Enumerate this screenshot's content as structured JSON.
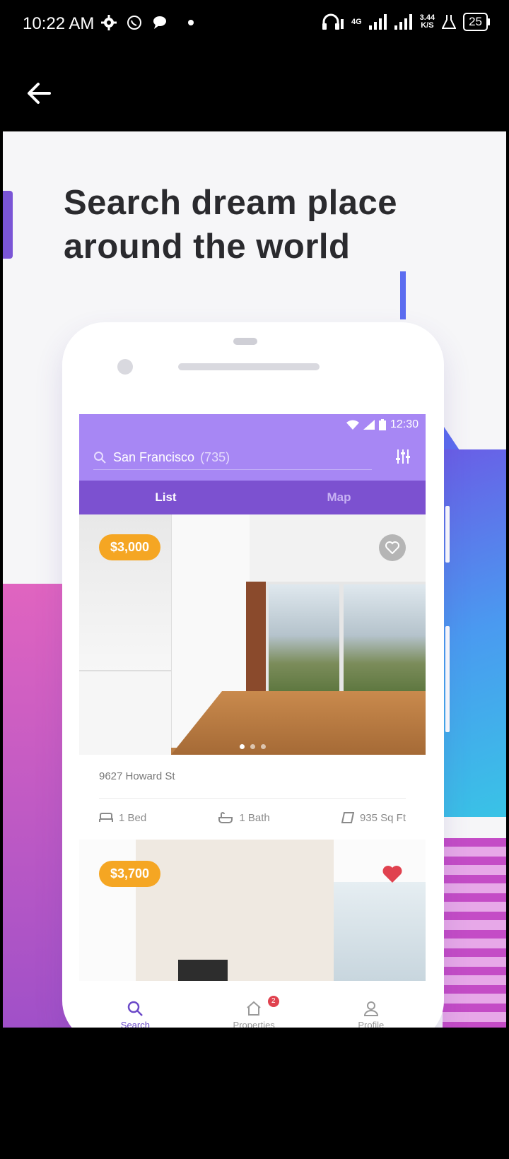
{
  "status_bar": {
    "time": "10:22 AM",
    "network": "4G",
    "speed_value": "3.44",
    "speed_unit": "K/S",
    "battery": "25",
    "icons": [
      "gear-icon",
      "whatsapp-icon",
      "chat-bubble-icon",
      "headphones-icon",
      "signal-icon",
      "flask-icon"
    ]
  },
  "app_bar": {
    "back_icon": "arrow-left-icon"
  },
  "hero": {
    "headline_line1": "Search dream place",
    "headline_line2": "around the world"
  },
  "mock_app": {
    "status_time": "12:30",
    "search": {
      "city": "San Francisco",
      "count": "(735)"
    },
    "tabs": [
      {
        "label": "List",
        "active": true
      },
      {
        "label": "Map",
        "active": false
      }
    ],
    "listings": [
      {
        "price": "$3,000",
        "address": "9627 Howard St",
        "beds": "1 Bed",
        "baths": "1 Bath",
        "size": "935 Sq Ft",
        "favorited": false
      },
      {
        "price": "$3,700",
        "favorited": true
      }
    ],
    "bottom_nav": [
      {
        "label": "Search",
        "icon": "search-icon",
        "active": true
      },
      {
        "label": "Properties",
        "icon": "home-icon",
        "badge": "2"
      },
      {
        "label": "Profile",
        "icon": "user-icon"
      }
    ]
  },
  "colors": {
    "primary_purple": "#a787f4",
    "tab_purple": "#7c51d0",
    "price_orange": "#f5a623",
    "heart_red": "#e0424f",
    "headline": "#2a2a2e"
  }
}
